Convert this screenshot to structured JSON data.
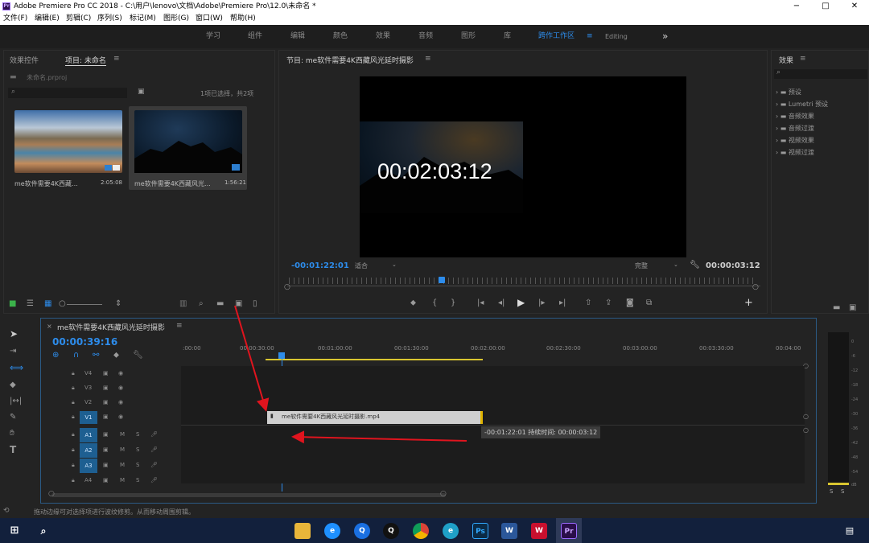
{
  "window": {
    "title": "Adobe Premiere Pro CC 2018 - C:\\用户\\lenovo\\文档\\Adobe\\Premiere Pro\\12.0\\未命名 *",
    "app_icon": "Pr",
    "controls": {
      "minimize": "−",
      "maximize": "□",
      "close": "✕"
    }
  },
  "menu": [
    "文件(F)",
    "编辑(E)",
    "剪辑(C)",
    "序列(S)",
    "标记(M)",
    "图形(G)",
    "窗口(W)",
    "帮助(H)"
  ],
  "workspaces": {
    "items": [
      "学习",
      "组件",
      "编辑",
      "颜色",
      "效果",
      "音频",
      "图形",
      "库"
    ],
    "active": "跨作工作区",
    "editing": "Editing",
    "more": "»"
  },
  "project_panel": {
    "tab_effect_controls": "效果控件",
    "tab_project": "项目: 未命名",
    "project_file": "未命名.prproj",
    "selection_info": "1项已选择，共2项",
    "items": [
      {
        "name": "me软件需要4K西藏...",
        "duration": "2:05:08"
      },
      {
        "name": "me软件需要4K西藏风光...",
        "duration": "1:56:21"
      }
    ]
  },
  "program_monitor": {
    "title": "节目: me软件需要4K西藏风光延时摄影",
    "timecode_overlay": "00:02:03:12",
    "current_time": "-00:01:22:01",
    "fit": "适合",
    "quality": "完整",
    "duration": "00:00:03:12"
  },
  "effects_panel": {
    "title": "效果",
    "folders": [
      "预设",
      "Lumetri 预设",
      "音频效果",
      "音频过渡",
      "视频效果",
      "视频过渡"
    ]
  },
  "timeline": {
    "sequence_name": "me软件需要4K西藏风光延时摄影",
    "timecode": "00:00:39:16",
    "ruler": [
      ":00:00",
      "00:00:30:00",
      "00:01:00:00",
      "00:01:30:00",
      "00:02:00:00",
      "00:02:30:00",
      "00:03:00:00",
      "00:03:30:00",
      "00:04:00"
    ],
    "video_tracks": [
      "V4",
      "V3",
      "V2",
      "V1"
    ],
    "audio_tracks": [
      "A1",
      "A2",
      "A3",
      "A4"
    ],
    "track_buttons": {
      "mute": "M",
      "solo": "S"
    },
    "clip_name": "me软件需要4K西藏风光延时摄影.mp4",
    "tooltip": "-00:01:22:01 持续时间: 00:00:03:12"
  },
  "audio_meter": {
    "labels": [
      "0",
      "-6",
      "-12",
      "-18",
      "-24",
      "-30",
      "-36",
      "-42",
      "-48",
      "-54",
      "dB"
    ],
    "solo_labels": [
      "S",
      "S"
    ]
  },
  "status_bar": {
    "text": "拖动边缘可对选择项进行波纹修剪。从而移动周围剪辑。"
  },
  "taskbar": {
    "apps": [
      "文件资源管理器",
      "IE",
      "QQ浏览器",
      "QQ",
      "Chrome",
      "Edge",
      "Photoshop",
      "Word",
      "WPS",
      "Premiere"
    ]
  },
  "colors": {
    "accent_blue": "#2d8ceb",
    "clip_fill": "#cfcfcf",
    "clip_end": "#e0b400",
    "annotation_red": "#e0141e",
    "work_area_yellow": "#d9c630"
  }
}
